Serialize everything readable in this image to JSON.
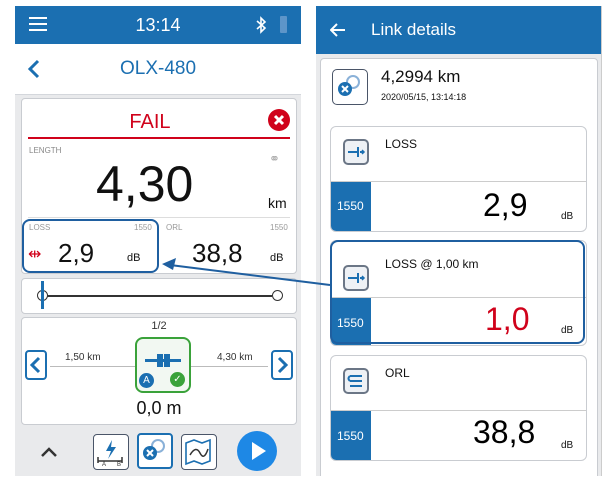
{
  "left": {
    "status_time": "13:14",
    "title": "OLX-480",
    "result": "FAIL",
    "length_label": "LENGTH",
    "length_value": "4,30",
    "length_unit": "km",
    "loss_label": "LOSS",
    "loss_wavelength": "1550",
    "loss_value": "2,9",
    "loss_unit": "dB",
    "orl_label": "ORL",
    "orl_wavelength": "1550",
    "orl_value": "38,8",
    "orl_unit": "dB",
    "page_indicator": "1/2",
    "event_left_distance": "1,50 km",
    "event_right_distance": "4,30 km",
    "event_marker": "A",
    "event_position": "0,0 m"
  },
  "right": {
    "title": "Link details",
    "link_length": "4,2994 km",
    "link_timestamp": "2020/05/15, 13:14:18",
    "cards": [
      {
        "label": "LOSS",
        "wavelength": "1550",
        "value": "2,9",
        "unit": "dB",
        "value_color": "#000000"
      },
      {
        "label": "LOSS @ 1,00 km",
        "wavelength": "1550",
        "value": "1,0",
        "unit": "dB",
        "value_color": "#d0021b"
      },
      {
        "label": "ORL",
        "wavelength": "1550",
        "value": "38,8",
        "unit": "dB",
        "value_color": "#000000"
      }
    ]
  },
  "colors": {
    "brand": "#1b6fb1",
    "fail": "#d0021b",
    "pass": "#3aa23a"
  }
}
